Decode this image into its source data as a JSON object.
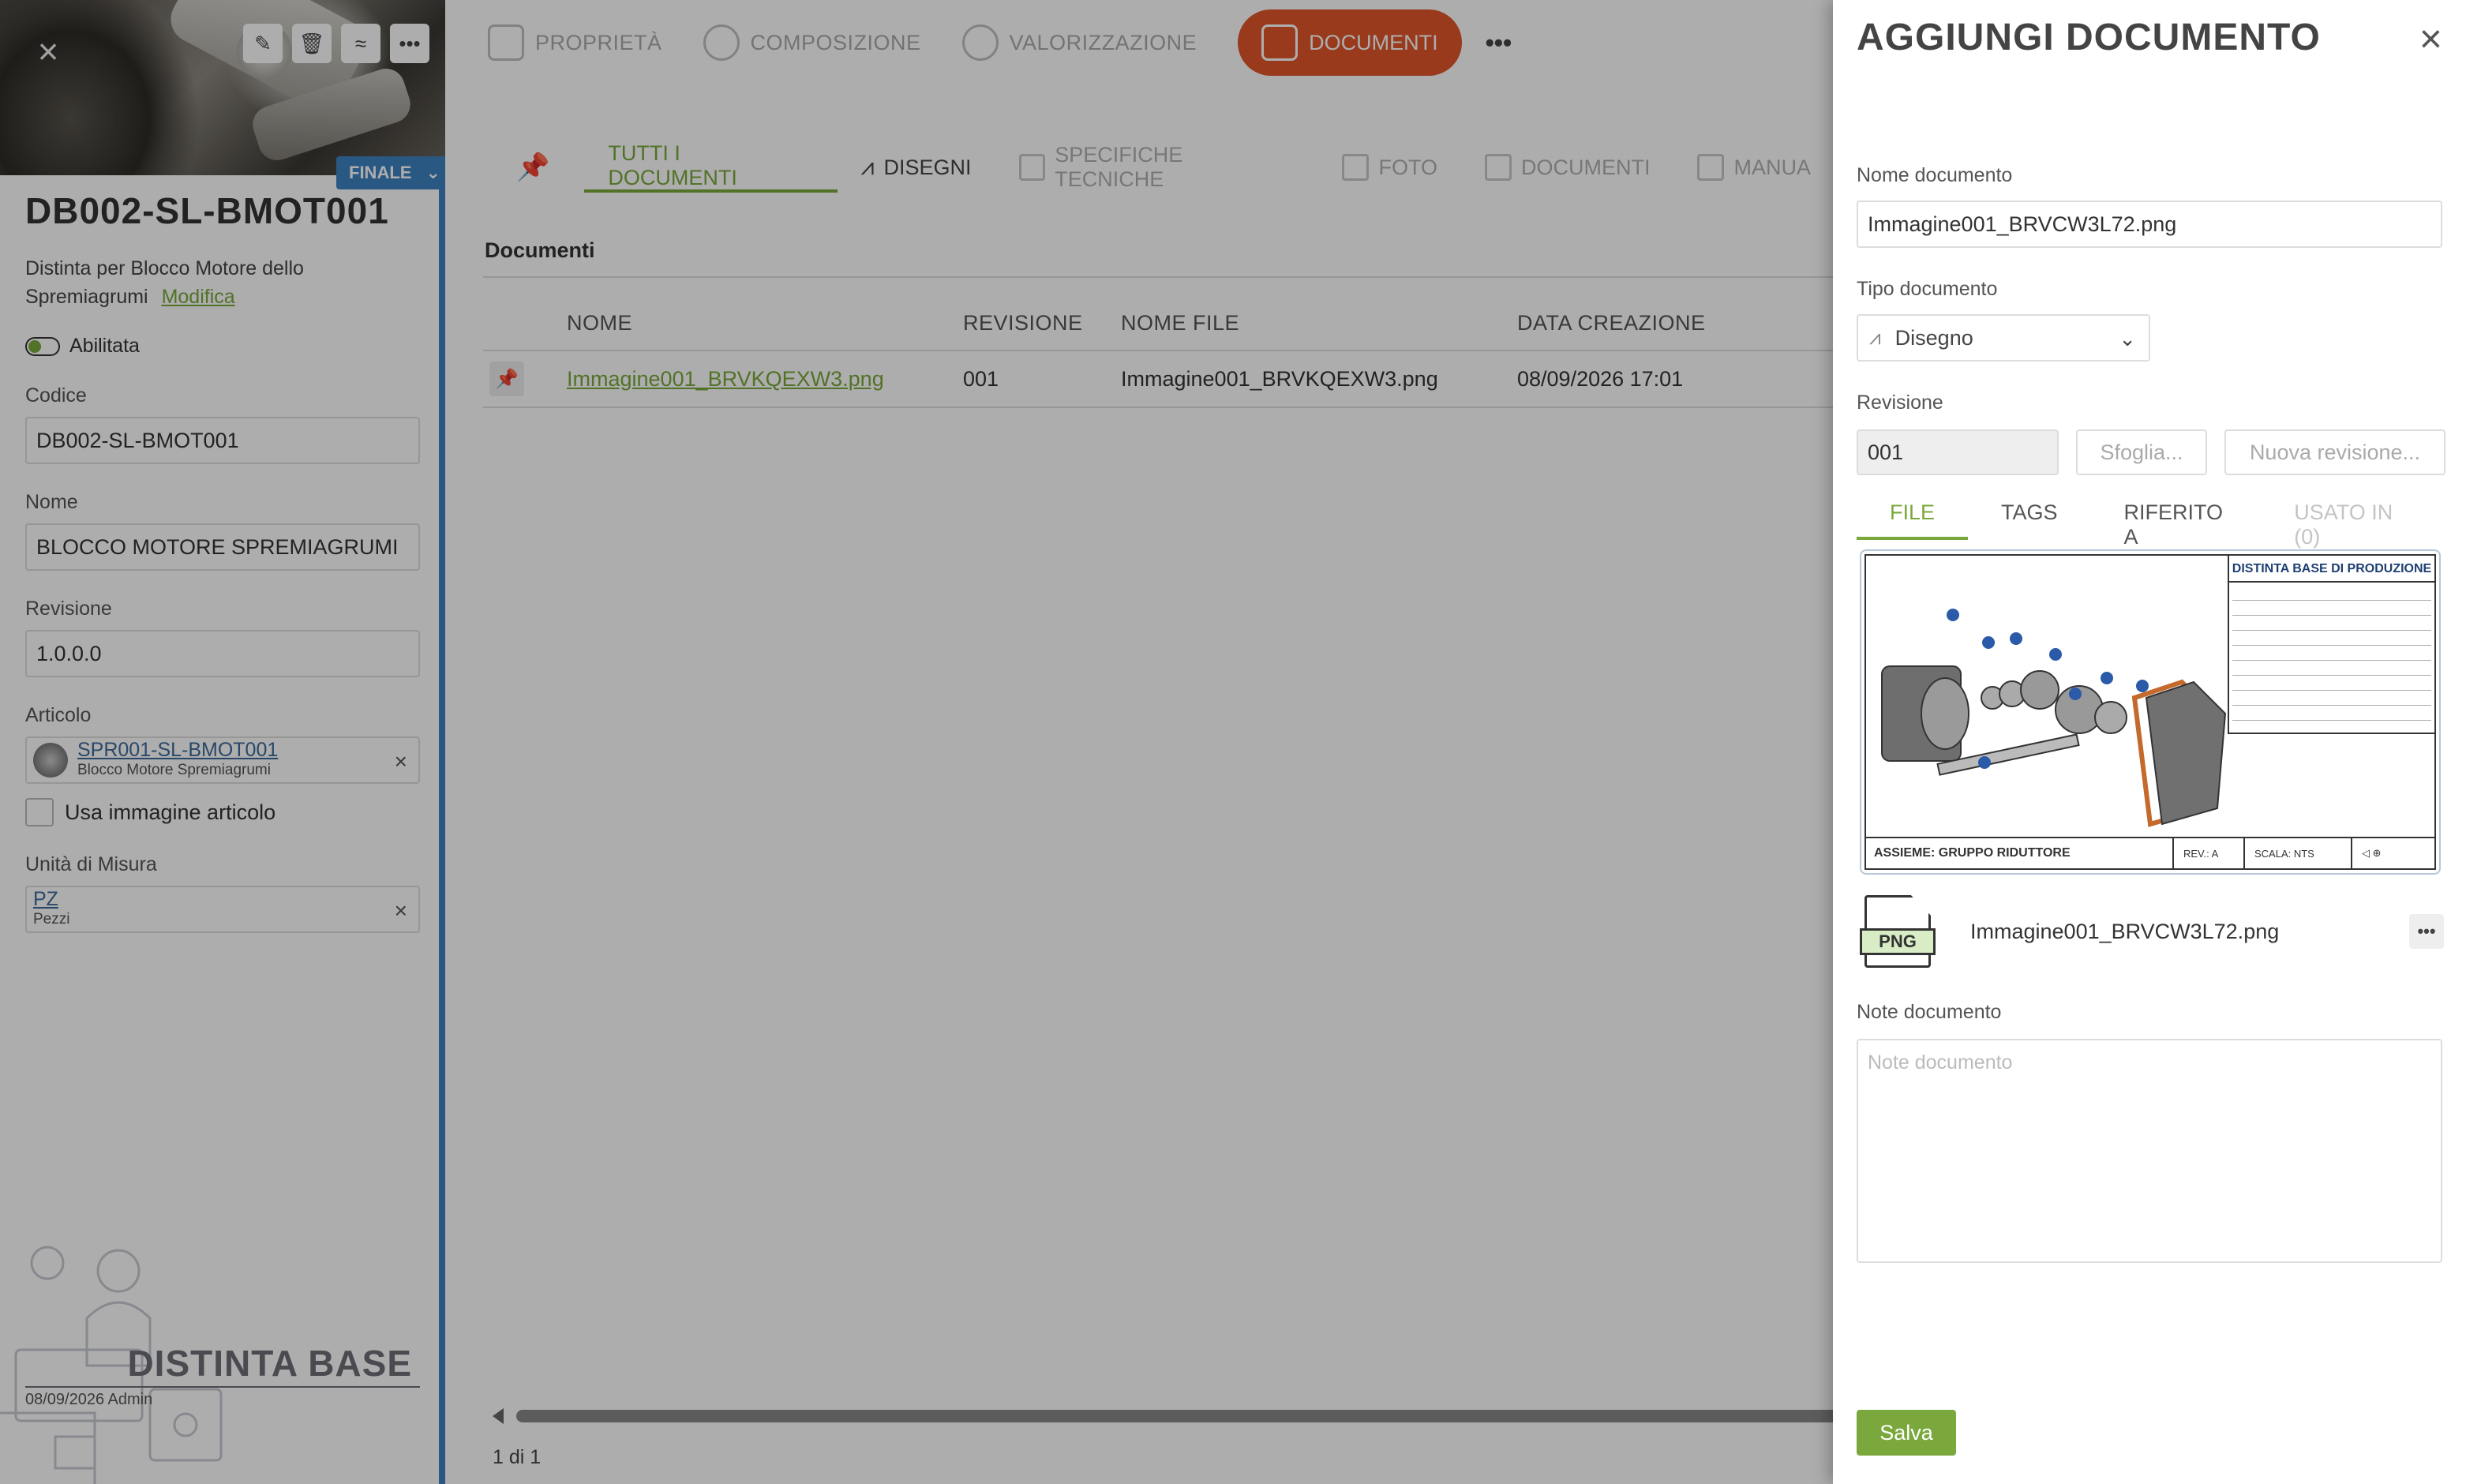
{
  "left": {
    "code": "DB002-SL-BMOT001",
    "status": "FINALE",
    "description": "Distinta per Blocco Motore dello Spremiagrumi",
    "edit_link": "Modifica",
    "enabled_label": "Abilitata",
    "fields": {
      "codice_label": "Codice",
      "codice_value": "DB002-SL-BMOT001",
      "nome_label": "Nome",
      "nome_value": "BLOCCO MOTORE SPREMIAGRUMI",
      "revisione_label": "Revisione",
      "revisione_value": "1.0.0.0",
      "articolo_label": "Articolo",
      "articolo_code": "SPR001-SL-BMOT001",
      "articolo_name": "Blocco Motore Spremiagrumi",
      "usa_immagine_label": "Usa immagine articolo",
      "um_label": "Unità di Misura",
      "um_code": "PZ",
      "um_name": "Pezzi"
    },
    "footer_title": "DISTINTA BASE",
    "footer_meta": "08/09/2026 Admin"
  },
  "nav": {
    "items": [
      {
        "label": "PROPRIETÀ",
        "icon": "properties-icon"
      },
      {
        "label": "COMPOSIZIONE",
        "icon": "composition-icon"
      },
      {
        "label": "VALORIZZAZIONE",
        "icon": "gauge-icon"
      }
    ],
    "active": "DOCUMENTI",
    "more": "•••"
  },
  "subtabs": {
    "all": "TUTTI I DOCUMENTI",
    "drawings": "DISEGNI",
    "specs": "SPECIFICHE TECNICHE",
    "photos": "FOTO",
    "documents": "DOCUMENTI",
    "manuals": "MANUA"
  },
  "table": {
    "section_title": "Documenti",
    "headers": [
      "NOME",
      "REVISIONE",
      "NOME FILE",
      "DATA CREAZIONE"
    ],
    "rows": [
      {
        "name": "Immagine001_BRVKQEXW3.png",
        "revision": "001",
        "file": "Immagine001_BRVKQEXW3.png",
        "created": "08/09/2026 17:01"
      }
    ],
    "pager": "1 di 1"
  },
  "drawer": {
    "title": "AGGIUNGI DOCUMENTO",
    "name_label": "Nome documento",
    "name_value": "Immagine001_BRVCW3L72.png",
    "type_label": "Tipo documento",
    "type_value": "Disegno",
    "revision_label": "Revisione",
    "revision_value": "001",
    "browse_button": "Sfoglia...",
    "new_revision_button": "Nuova revisione...",
    "tabs": [
      "FILE",
      "TAGS",
      "RIFERITO A",
      "USATO IN (0)"
    ],
    "preview": {
      "table_title": "DISTINTA BASE DI PRODUZIONE",
      "assembly": "ASSIEME: GRUPPO RIDUTTORE",
      "rev": "REV.: A",
      "scale": "SCALA: NTS"
    },
    "file_name": "Immagine001_BRVCW3L72.png",
    "file_badge": "PNG",
    "notes_label": "Note documento",
    "notes_placeholder": "Note documento",
    "save_button": "Salva"
  },
  "colors": {
    "accent_green": "#7aa83c",
    "active_orange": "#e2562c",
    "status_blue": "#3d82c1"
  }
}
